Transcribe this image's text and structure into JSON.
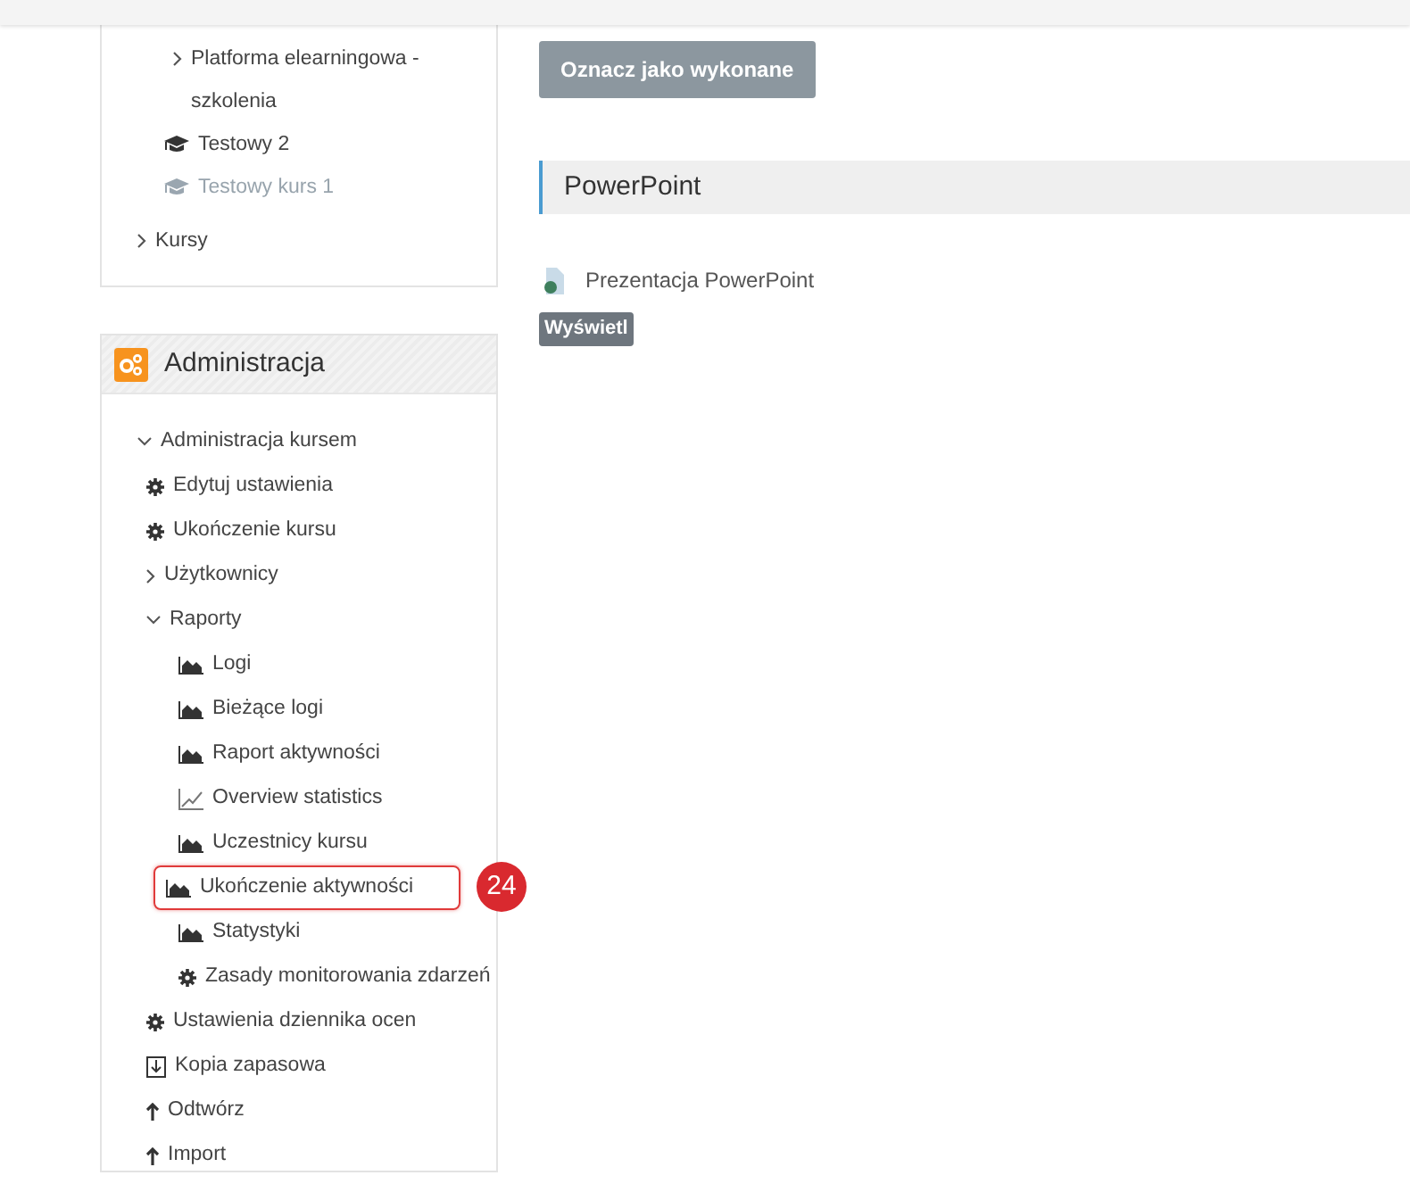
{
  "nav_block": {
    "partial_items": [
      {
        "label": "Platforma elearningowa - szkolenia",
        "kind": "folder",
        "expanded": false,
        "dimmed": false
      },
      {
        "label": "Testowy 2",
        "kind": "course",
        "dimmed": false
      },
      {
        "label": "Testowy kurs 1",
        "kind": "course",
        "dimmed": true
      }
    ],
    "items": [
      {
        "label": "Kursy",
        "kind": "folder",
        "expanded": false,
        "dimmed": false
      }
    ]
  },
  "admin_block": {
    "title": "Administracja",
    "tree": [
      {
        "label": "Administracja kursem",
        "kind": "folder",
        "expanded": true,
        "children": [
          {
            "label": "Edytuj ustawienia",
            "kind": "gear"
          },
          {
            "label": "Ukończenie kursu",
            "kind": "gear"
          },
          {
            "label": "Użytkownicy",
            "kind": "folder",
            "expanded": false
          },
          {
            "label": "Raporty",
            "kind": "folder",
            "expanded": true,
            "children": [
              {
                "label": "Logi",
                "kind": "area-chart"
              },
              {
                "label": "Bieżące logi",
                "kind": "area-chart"
              },
              {
                "label": "Raport aktywności",
                "kind": "area-chart"
              },
              {
                "label": "Overview statistics",
                "kind": "line-chart"
              },
              {
                "label": "Uczestnicy kursu",
                "kind": "area-chart"
              },
              {
                "label": "Ukończenie aktywności",
                "kind": "area-chart",
                "highlighted": true,
                "callout": "24"
              },
              {
                "label": "Statystyki",
                "kind": "area-chart"
              },
              {
                "label": "Zasady monitorowania zdarzeń",
                "kind": "gear"
              }
            ]
          },
          {
            "label": "Ustawienia dziennika ocen",
            "kind": "gear"
          },
          {
            "label": "Kopia zapasowa",
            "kind": "backup"
          },
          {
            "label": "Odtwórz",
            "kind": "upload"
          },
          {
            "label": "Import",
            "kind": "upload"
          }
        ]
      }
    ]
  },
  "main": {
    "complete_button": "Oznacz jako wykonane",
    "section_title": "PowerPoint",
    "resource": {
      "name": "Prezentacja PowerPoint",
      "badge": "Wyświetl"
    }
  }
}
